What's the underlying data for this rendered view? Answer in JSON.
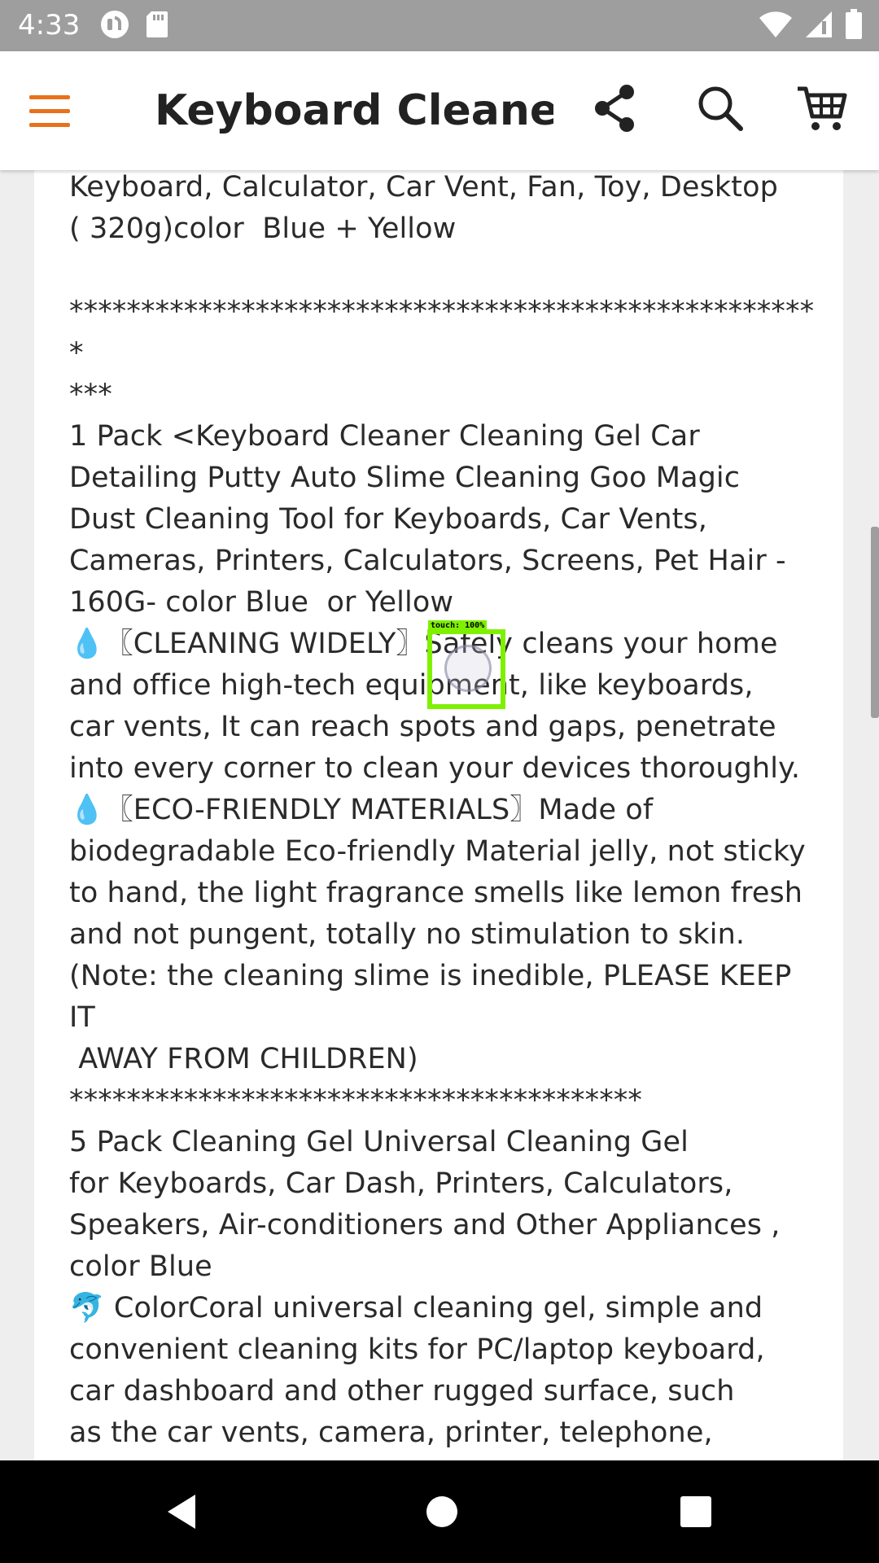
{
  "status_bar": {
    "time": "4:33",
    "left_icons": [
      "headset-icon",
      "sd-card-icon"
    ],
    "right_icons": [
      "wifi-icon",
      "signal-icon",
      "battery-icon"
    ]
  },
  "app_bar": {
    "title": "Keyboard Cleane...",
    "accent_color": "#e8711c",
    "icons": [
      "menu-icon",
      "share-icon",
      "search-icon",
      "cart-icon"
    ]
  },
  "content": {
    "description": "                                                                      \nKeyboard, Calculator, Car Vent, Fan, Toy, Desktop\n( 320g)color  Blue + Yellow\n\n*****************************************************\n***\n1 Pack <Keyboard Cleaner Cleaning Gel Car\nDetailing Putty Auto Slime Cleaning Goo Magic\nDust Cleaning Tool for Keyboards, Car Vents,\nCameras, Printers, Calculators, Screens, Pet Hair -\n160G- color Blue  or Yellow\n💧〖CLEANING WIDELY〗Safely cleans your home\nand office high-tech equipment, like keyboards,\ncar vents, It can reach spots and gaps, penetrate\ninto every corner to clean your devices thoroughly.\n💧〖ECO-FRIENDLY MATERIALS〗Made of\nbiodegradable Eco-friendly Material jelly, not sticky\nto hand, the light fragrance smells like lemon fresh\nand not pungent, totally no stimulation to skin.\n(Note: the cleaning slime is inedible, PLEASE KEEP\nIT\n AWAY FROM CHILDREN)\n****************************************\n5 Pack Cleaning Gel Universal Cleaning Gel\nfor Keyboards, Car Dash, Printers, Calculators,\nSpeakers, Air-conditioners and Other Appliances ,\ncolor Blue\n🐬 ColorCoral universal cleaning gel, simple and\nconvenient cleaning kits for PC/laptop keyboard,\ncar dashboard and other rugged surface, such\nas the car vents, camera, printer, telephone,\ncalculator , speaker, air conditioner, TV and other"
  },
  "touch_indicator": {
    "label": "touch: 100%",
    "color": "#7ff000"
  },
  "nav_bar": {
    "icons": [
      "back-icon",
      "home-icon",
      "recents-icon"
    ]
  }
}
